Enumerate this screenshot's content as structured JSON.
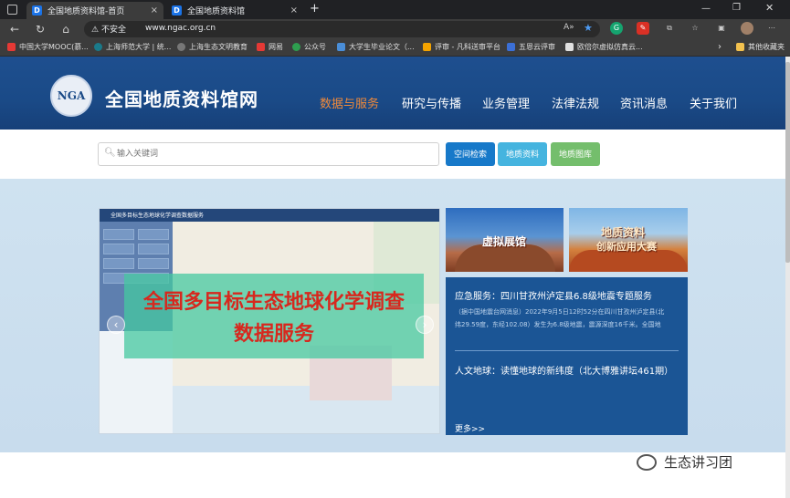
{
  "browser": {
    "tabs": [
      {
        "title": "全国地质资料馆-首页",
        "close": "×"
      },
      {
        "title": "全国地质资料馆",
        "close": "×"
      }
    ],
    "new_tab": "+",
    "security_warning": "不安全",
    "url": "www.ngac.org.cn",
    "bookmarks": [
      "中国大学MOOC(慕...",
      "上海师范大学 | 统...",
      "上海生态文明教育",
      "网易",
      "公众号",
      "大学生毕业论文（...",
      "评审 - 凡科送审平台",
      "五恩云评审",
      "欧倍尔虚拟仿真云..."
    ],
    "bookmarks_more": "其他收藏夹"
  },
  "site": {
    "logo_text": "NGA",
    "title": "全国地质资料馆网",
    "nav": [
      "数据与服务",
      "研究与传播",
      "业务管理",
      "法律法规",
      "资讯消息",
      "关于我们"
    ],
    "nav_active_index": 0,
    "colors": {
      "header_bg": "#1a4a87",
      "nav_active": "#f08a3b",
      "panel_bg": "#1b5595"
    }
  },
  "search": {
    "placeholder": "输入关键词",
    "buttons": [
      {
        "label": "空间检索",
        "color": "#1779c9"
      },
      {
        "label": "地质资料",
        "color": "#45b4df"
      },
      {
        "label": "地质图库",
        "color": "#74be6c"
      }
    ]
  },
  "slider": {
    "screenshot_title": "全国多目标生态地球化学调查数据服务",
    "line1": "全国多目标生态地球化学调查",
    "line2": "数据服务",
    "prev": "‹",
    "next": "›"
  },
  "thumbs": [
    {
      "title": "虚拟展馆"
    },
    {
      "title_line1": "地质资料",
      "title_line2": "创新应用大赛"
    }
  ],
  "news": {
    "item1_title": "应急服务：四川甘孜州泸定县6.8级地震专题服务",
    "item1_desc_line1": "（据中国地震台网消息）2022年9月5日12时52分在四川甘孜州泸定县(北",
    "item1_desc_line2": "纬29.59度，东经102.08）发生为6.8级地震，震源深度16千米。全国地",
    "item2_title": "人文地球：读懂地球的新纬度（北大博雅讲坛461期）",
    "more": "更多>>"
  },
  "watermark": "生态讲习团"
}
